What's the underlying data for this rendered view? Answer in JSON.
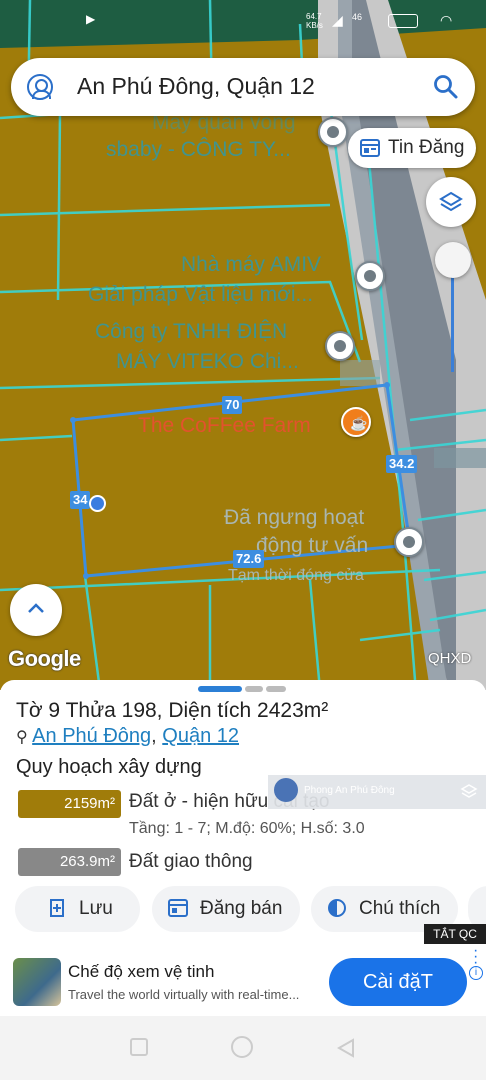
{
  "status_bar": {
    "speed": "64.7\nKB/s",
    "battery_pct": "46"
  },
  "search": {
    "query": "An Phú Đông, Quận 12"
  },
  "map": {
    "labels": [
      {
        "id": "lbl-may",
        "text": "May quần vòng"
      },
      {
        "id": "lbl-sbaby",
        "text": "sbaby - CÔNG TY..."
      },
      {
        "id": "lbl-amiv",
        "text": "Nhà máy AMIV"
      },
      {
        "id": "lbl-amiv2",
        "text": "Giải pháp Vật liệu mới..."
      },
      {
        "id": "lbl-viteko1",
        "text": "Công ty TNHH ĐIỆN"
      },
      {
        "id": "lbl-viteko2",
        "text": "MÁY VITEKO Chi..."
      },
      {
        "id": "lbl-coffee",
        "text": "The CoFFee Farm"
      },
      {
        "id": "lbl-ngung1",
        "text": "Đã ngưng hoạt"
      },
      {
        "id": "lbl-ngung2",
        "text": "động tư vấn"
      },
      {
        "id": "lbl-tamthoi",
        "text": "Tạm thời đóng cửa"
      }
    ],
    "edge_lengths": {
      "top": "70",
      "right": "34.2",
      "bottom": "72.6",
      "left": "34"
    },
    "attribution": "Google",
    "layer_code": "QHXD",
    "colors": {
      "residential": "#a07c0a",
      "road": "#cfcfcf",
      "parcel_outline": "#3d8ee0"
    }
  },
  "controls": {
    "tin_dang": "Tin Đăng",
    "icons": [
      "account-icon",
      "search-icon",
      "calendar-icon",
      "layers-icon",
      "chevron-up-icon"
    ]
  },
  "parcel": {
    "title": "Tờ 9 Thửa 198, Diện tích 2423m²",
    "ward": "An Phú Đông",
    "district": "Quận 12",
    "separator": ", ",
    "plan_heading": "Quy hoạch xây dựng",
    "land_use": [
      {
        "area": "2159m²",
        "label": "Đất ở - hiện hữu cải tạo",
        "detail": "Tầng: 1 - 7; M.độ: 60%; H.số: 3.0",
        "color": "#a07c0a"
      },
      {
        "area": "263.9m²",
        "label": "Đất giao thông",
        "color": "#888888"
      }
    ]
  },
  "actions": {
    "save": "Lưu",
    "post_sale": "Đăng bán",
    "legend": "Chú thích"
  },
  "banner": {
    "text": "Phong An Phú Đông"
  },
  "ad": {
    "close_label": "TẮT QC",
    "title": "Chế độ xem vệ tinh",
    "subtitle": "Travel the world virtually with real-time...",
    "cta": "Cài đặT",
    "info": "i"
  }
}
